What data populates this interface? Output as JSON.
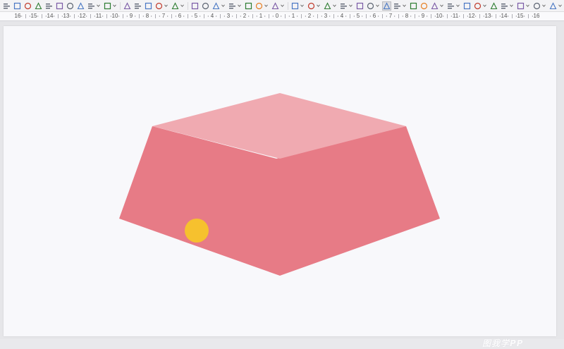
{
  "toolbar": {
    "icons": [
      {
        "name": "align-left-icon",
        "caret": false
      },
      {
        "name": "align-center-horizontal-icon",
        "caret": false
      },
      {
        "name": "align-right-icon",
        "caret": false
      },
      {
        "name": "align-top-icon",
        "caret": false
      },
      {
        "name": "align-center-vertical-icon",
        "caret": false
      },
      {
        "name": "align-bottom-icon",
        "caret": false
      },
      {
        "name": "distribute-horizontal-icon",
        "caret": false
      },
      {
        "name": "distribute-vertical-icon",
        "caret": false
      },
      {
        "name": "arrange-icon",
        "caret": true
      },
      {
        "name": "group-icon",
        "caret": true
      },
      {
        "name": "sep",
        "caret": false
      },
      {
        "name": "fill-bucket-icon",
        "caret": false
      },
      {
        "name": "line-color-icon",
        "caret": false
      },
      {
        "name": "crop-icon",
        "caret": false
      },
      {
        "name": "shape-circle-icon",
        "caret": true
      },
      {
        "name": "shape-styles-icon",
        "caret": true
      },
      {
        "name": "sep",
        "caret": false
      },
      {
        "name": "replace-image-icon",
        "caret": false
      },
      {
        "name": "image-icon",
        "caret": false
      },
      {
        "name": "flag-icon",
        "caret": true
      },
      {
        "name": "chart-box-icon",
        "caret": true
      },
      {
        "name": "text-box-icon",
        "caret": false
      },
      {
        "name": "draw-icon",
        "caret": true
      },
      {
        "name": "font-style-icon",
        "caret": true
      },
      {
        "name": "sep",
        "caret": false
      },
      {
        "name": "border-icon",
        "caret": true
      },
      {
        "name": "table-icon",
        "caret": true
      },
      {
        "name": "character-spacing-icon",
        "caret": true
      },
      {
        "name": "smartart-icon",
        "caret": true
      },
      {
        "name": "animation-icon",
        "caret": false
      },
      {
        "name": "transition-icon",
        "caret": true
      },
      {
        "name": "frame-icon",
        "caret": false,
        "pressed": true
      },
      {
        "name": "rotate-icon",
        "caret": true
      },
      {
        "name": "color-picker-icon",
        "caret": false
      },
      {
        "name": "record-icon",
        "caret": false
      },
      {
        "name": "effects-icon",
        "caret": true
      },
      {
        "name": "3d-icon",
        "caret": true
      },
      {
        "name": "stop-icon",
        "caret": false
      },
      {
        "name": "shape-outline-icon",
        "caret": true
      },
      {
        "name": "globe-icon",
        "caret": false
      },
      {
        "name": "file-icon",
        "caret": true
      },
      {
        "name": "page-icon",
        "caret": true
      },
      {
        "name": "slide-icon",
        "caret": true
      },
      {
        "name": "picture-icon",
        "caret": true
      },
      {
        "name": "bar-icon",
        "caret": true
      },
      {
        "name": "more-icon",
        "caret": false
      }
    ]
  },
  "ruler": {
    "labels": [
      "16",
      "15",
      "14",
      "13",
      "12",
      "11",
      "10",
      "9",
      "8",
      "7",
      "6",
      "5",
      "4",
      "3",
      "2",
      "1",
      "0",
      "1",
      "2",
      "3",
      "4",
      "5",
      "6",
      "7",
      "8",
      "9",
      "10",
      "11",
      "12",
      "13",
      "14",
      "15",
      "16"
    ]
  },
  "slide": {
    "colors": {
      "top_face": "#f0aab1",
      "front_face": "#e77b86",
      "dot": "#f6c12e",
      "background": "#f8f8fb"
    },
    "watermark": "图我学PP"
  }
}
